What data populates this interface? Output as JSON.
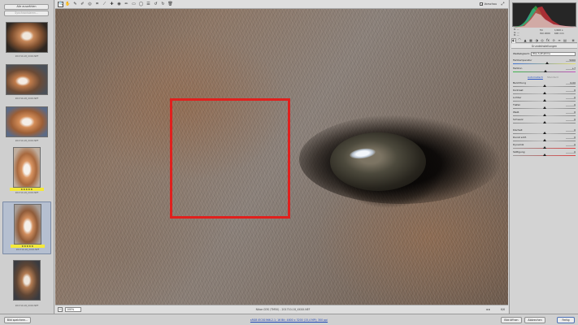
{
  "filmstrip": {
    "select_all_label": "Alle auswählen",
    "synchronize_label": "Synchronisieren...",
    "thumbnails": [
      {
        "caption": "201710-18_XXXX.NEF",
        "rating": "",
        "selected": false
      },
      {
        "caption": "201710-18_XXXX.NEF",
        "rating": "",
        "selected": false
      },
      {
        "caption": "201710-18_XXXX.NEF",
        "rating": "",
        "selected": false
      },
      {
        "caption": "201710-18_XXXX.NEF",
        "rating": "★★★★★",
        "selected": false
      },
      {
        "caption": "201710-18_XXXX.NEF",
        "rating": "★★★★★",
        "selected": true
      },
      {
        "caption": "201710-18_XXXX.NEF",
        "rating": "",
        "selected": false
      }
    ]
  },
  "toolbar": {
    "tools": [
      {
        "icon": "zoom-icon",
        "glyph": "🔍"
      },
      {
        "icon": "hand-icon",
        "glyph": "✋"
      },
      {
        "icon": "white-balance-icon",
        "glyph": "✎"
      },
      {
        "icon": "color-sampler-icon",
        "glyph": "✐"
      },
      {
        "icon": "targeted-adjustment-icon",
        "glyph": "◎"
      },
      {
        "icon": "crop-icon",
        "glyph": "⌗"
      },
      {
        "icon": "straighten-icon",
        "glyph": "⟋"
      },
      {
        "icon": "spot-removal-icon",
        "glyph": "✚"
      },
      {
        "icon": "red-eye-icon",
        "glyph": "◉"
      },
      {
        "icon": "adjustment-brush-icon",
        "glyph": "✏"
      },
      {
        "icon": "graduated-filter-icon",
        "glyph": "▭"
      },
      {
        "icon": "radial-filter-icon",
        "glyph": "◯"
      },
      {
        "icon": "preferences-icon",
        "glyph": "☰"
      },
      {
        "icon": "rotate-left-icon",
        "glyph": "↺"
      },
      {
        "icon": "rotate-right-icon",
        "glyph": "↻"
      },
      {
        "icon": "trash-icon",
        "glyph": "🗑"
      }
    ],
    "preview_label": "Vorschau",
    "preview_checked": "✓",
    "fullscreen_glyph": "⤢"
  },
  "status": {
    "zoom_value": "100%",
    "camera_info": "Nikon D3S (TM50) - 201710-18_XXXX.NEF",
    "counter": "6/6",
    "nav": "◂ ▸"
  },
  "readout": {
    "r": "R:  —",
    "g": "G:  —",
    "b": "B:  —",
    "aperture": "f/4",
    "shutter": "1/400 s",
    "iso": "ISO 2000",
    "focal": "600 mm"
  },
  "panel": {
    "section_title": "Grundeinstellungen",
    "wb_label": "Weißabgleich:",
    "wb_value": "Wie Aufnahme",
    "auto_label": "Automatisch",
    "default_label": "Standard",
    "sliders": {
      "temp": {
        "label": "Farbtemperatur",
        "value": "5200",
        "pos": 0.55
      },
      "tint": {
        "label": "Farbton",
        "value": "+7",
        "pos": 0.52
      },
      "exposure": {
        "label": "Belichtung",
        "value": "0,00",
        "pos": 0.5
      },
      "contrast": {
        "label": "Kontrast",
        "value": "0",
        "pos": 0.5
      },
      "highlights": {
        "label": "Lichter",
        "value": "0",
        "pos": 0.5
      },
      "shadows": {
        "label": "Tiefen",
        "value": "0",
        "pos": 0.5
      },
      "whites": {
        "label": "Weiß",
        "value": "0",
        "pos": 0.5
      },
      "blacks": {
        "label": "Schwarz",
        "value": "0",
        "pos": 0.5
      },
      "clarity": {
        "label": "Klarheit",
        "value": "0",
        "pos": 0.5
      },
      "dehaze": {
        "label": "Dunst entf.",
        "value": "0",
        "pos": 0.5
      },
      "vibrance": {
        "label": "Dynamik",
        "value": "0",
        "pos": 0.5
      },
      "saturation": {
        "label": "Sättigung",
        "value": "0",
        "pos": 0.5
      }
    }
  },
  "bottom": {
    "save_label": "Bild speichern...",
    "workflow_link": "sRGB IEC61966-2.1; 16 Bit; 4800 x 3200 (15,4 MP); 300 ppi",
    "open_label": "Bild öffnen",
    "cancel_label": "Abbrechen",
    "done_label": "Fertig"
  },
  "colors": {
    "crop_frame": "#e0201d",
    "star_badge": "#f4e93a",
    "link": "#1f47b8"
  }
}
